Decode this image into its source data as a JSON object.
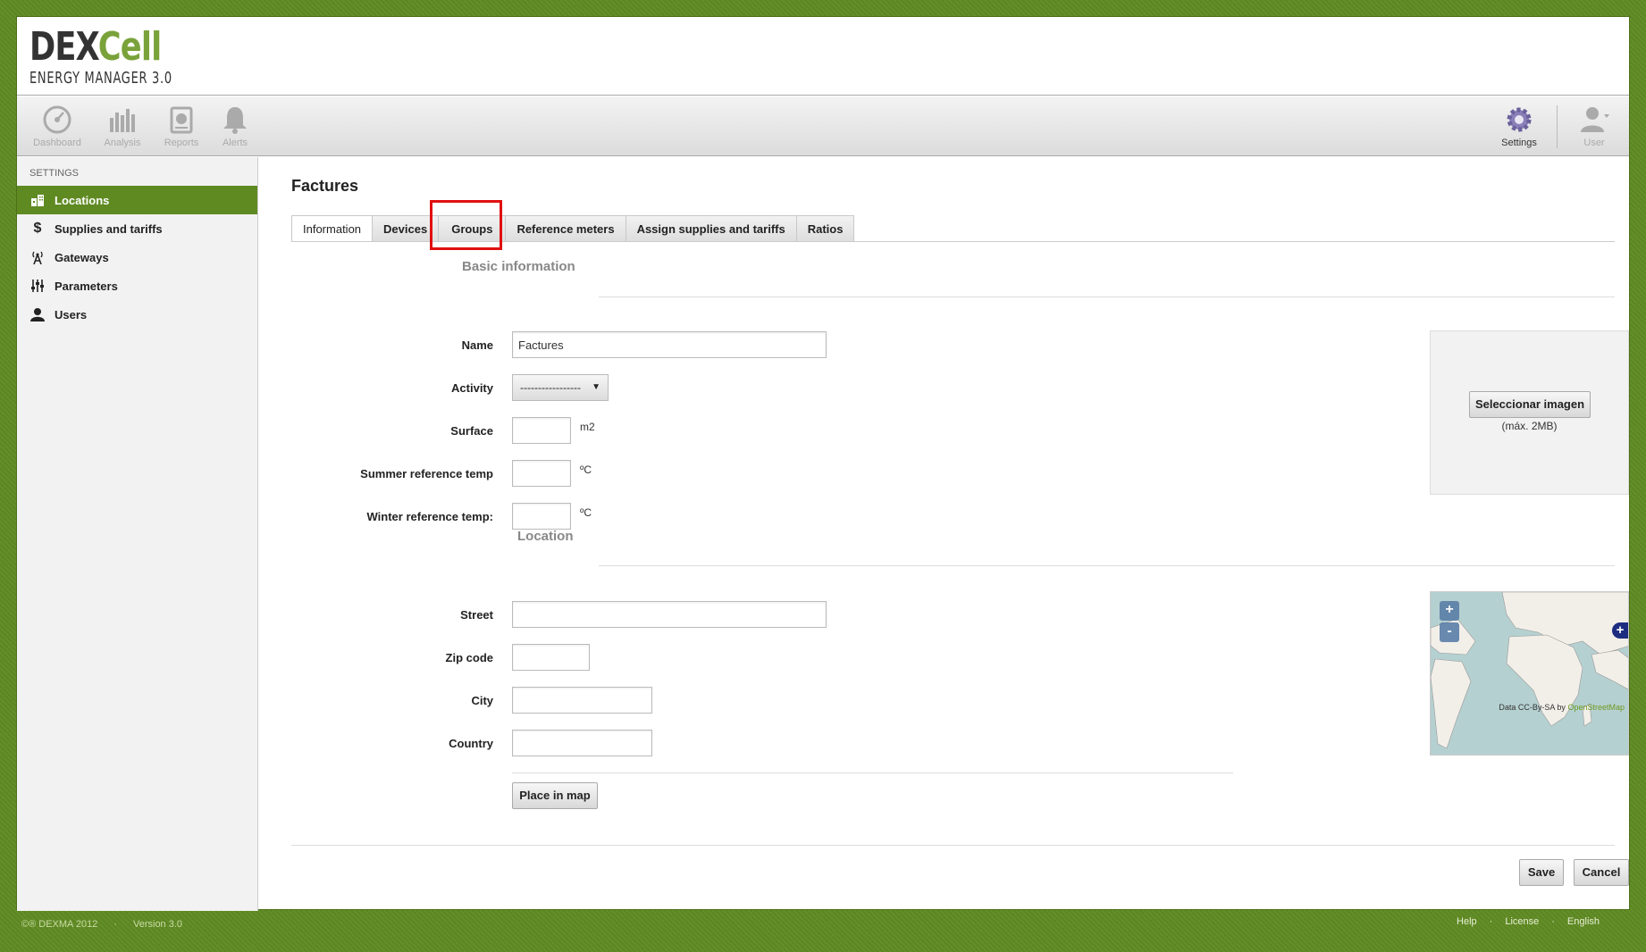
{
  "logo": {
    "brand_dark": "DEX",
    "brand_green": "Cell",
    "subtitle": "ENERGY MANAGER 3.0"
  },
  "toolbar": {
    "dashboard": "Dashboard",
    "analysis": "Analysis",
    "reports": "Reports",
    "alerts": "Alerts",
    "settings": "Settings",
    "user": "User"
  },
  "sidebar": {
    "title": "SETTINGS",
    "items": [
      {
        "label": "Locations",
        "icon": "building-icon"
      },
      {
        "label": "Supplies and tariffs",
        "icon": "dollar-icon"
      },
      {
        "label": "Gateways",
        "icon": "antenna-icon"
      },
      {
        "label": "Parameters",
        "icon": "sliders-icon"
      },
      {
        "label": "Users",
        "icon": "user-icon"
      }
    ]
  },
  "page": {
    "title": "Factures"
  },
  "tabs": [
    "Information",
    "Devices",
    "Groups",
    "Reference meters",
    "Assign supplies and tariffs",
    "Ratios"
  ],
  "basic": {
    "section": "Basic information",
    "name_label": "Name",
    "name_value": "Factures",
    "activity_label": "Activity",
    "activity_value": "-----------------",
    "surface_label": "Surface",
    "surface_unit": "m2",
    "summer_label": "Summer reference temp",
    "summer_unit": "ºC",
    "winter_label": "Winter reference temp:",
    "winter_unit": "ºC"
  },
  "image": {
    "button": "Seleccionar imagen",
    "note": "(máx. 2MB)"
  },
  "location": {
    "section": "Location",
    "street_label": "Street",
    "zip_label": "Zip code",
    "city_label": "City",
    "country_label": "Country",
    "place_button": "Place in map"
  },
  "map": {
    "zoom_in": "+",
    "zoom_out": "-",
    "layer": "+",
    "attr_prefix": "Data CC-By-SA by",
    "attr_link": "OpenStreetMap"
  },
  "actions": {
    "save": "Save",
    "cancel": "Cancel"
  },
  "footer": {
    "copyright": "©® DEXMA 2012",
    "version": "Version 3.0",
    "help": "Help",
    "license": "License",
    "language": "English"
  }
}
